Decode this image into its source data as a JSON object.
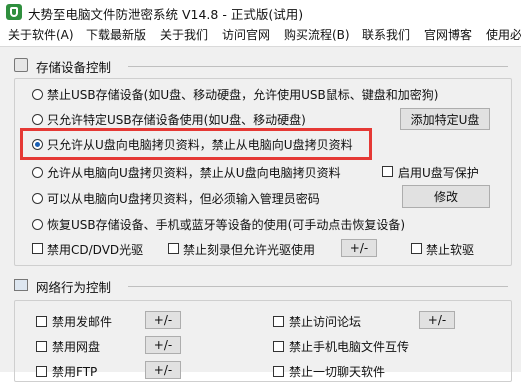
{
  "window": {
    "title": "大势至电脑文件防泄密系统 V14.8 - 正式版(试用)"
  },
  "menu": [
    "关于软件(A)",
    "下载最新版",
    "关于我们",
    "访问官网",
    "购买流程(B)",
    "联系我们",
    "官网博客",
    "使用必"
  ],
  "usb": {
    "section_title": "存储设备控制",
    "options": [
      "禁止USB存储设备(如U盘、移动硬盘，允许使用USB鼠标、键盘和加密狗)",
      "只允许特定USB存储设备使用(如U盘、移动硬盘)",
      "只允许从U盘向电脑拷贝资料，禁止从电脑向U盘拷贝资料",
      "允许从电脑向U盘拷贝资料，禁止从U盘向电脑拷贝资料",
      "可以从电脑向U盘拷贝资料，但必须输入管理员密码",
      "恢复USB存储设备、手机或蓝牙等设备的使用(可手动点击恢复设备)"
    ],
    "selected_index": 2,
    "add_button": "添加特定U盘",
    "write_protect": "启用U盘写保护",
    "modify_button": "修改",
    "disable_cd": "禁用CD/DVD光驱",
    "pm_button": "+/-",
    "no_burn": "禁止刻录但允许光驱使用",
    "disable_floppy": "禁止软驱"
  },
  "network": {
    "section_title": "网络行为控制",
    "items_left": [
      "禁用发邮件",
      "禁用网盘",
      "禁用FTP"
    ],
    "items_right": [
      "禁止访问论坛",
      "禁止手机电脑文件互传",
      "禁止一切聊天软件"
    ],
    "pm_button": "+/-"
  },
  "colors": {
    "highlight": "#e53935",
    "radio_dot": "#1a5fb4",
    "logo": "#2f8f3e"
  }
}
